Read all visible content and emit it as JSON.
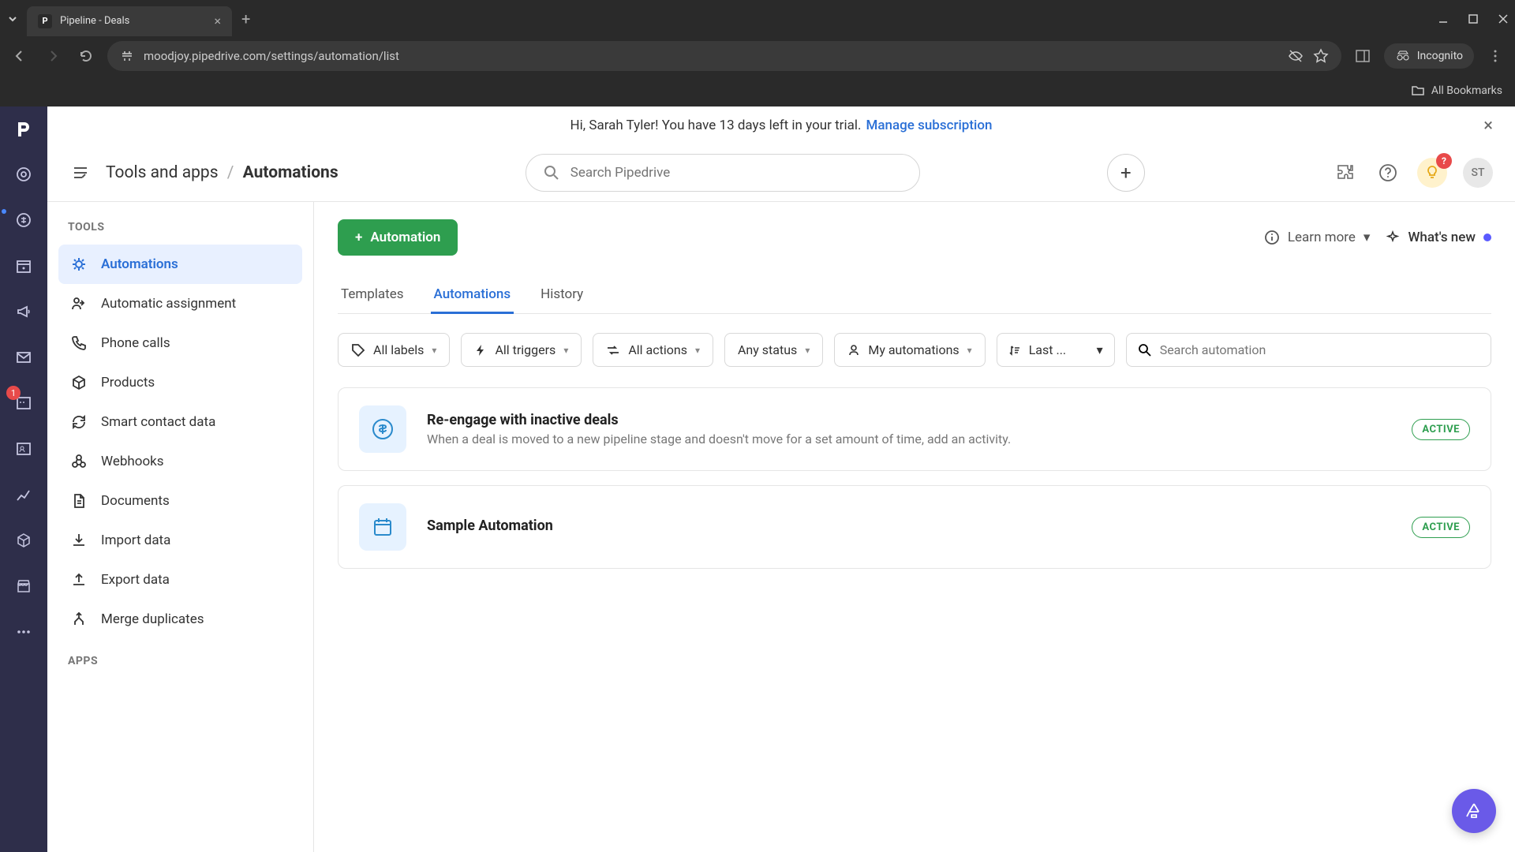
{
  "browser": {
    "tab_title": "Pipeline - Deals",
    "url": "moodjoy.pipedrive.com/settings/automation/list",
    "incognito_label": "Incognito",
    "bookmarks_label": "All Bookmarks"
  },
  "banner": {
    "greeting": "Hi, Sarah Tyler! You have 13 days left in your trial.",
    "link": "Manage subscription"
  },
  "breadcrumb": {
    "parent": "Tools and apps",
    "current": "Automations"
  },
  "search": {
    "placeholder": "Search Pipedrive"
  },
  "rail": {
    "badge_count": "1"
  },
  "header_right": {
    "bulb_badge": "?",
    "avatar_initials": "ST"
  },
  "sidebar": {
    "section1_title": "TOOLS",
    "section2_title": "APPS",
    "items": [
      {
        "label": "Automations"
      },
      {
        "label": "Automatic assignment"
      },
      {
        "label": "Phone calls"
      },
      {
        "label": "Products"
      },
      {
        "label": "Smart contact data"
      },
      {
        "label": "Webhooks"
      },
      {
        "label": "Documents"
      },
      {
        "label": "Import data"
      },
      {
        "label": "Export data"
      },
      {
        "label": "Merge duplicates"
      }
    ]
  },
  "content": {
    "primary_button": "Automation",
    "learn_more": "Learn more",
    "whats_new": "What's new"
  },
  "tabs": [
    {
      "label": "Templates"
    },
    {
      "label": "Automations"
    },
    {
      "label": "History"
    }
  ],
  "filters": {
    "labels": "All labels",
    "triggers": "All triggers",
    "actions": "All actions",
    "status": "Any status",
    "owner": "My automations",
    "sort": "Last ...",
    "search_placeholder": "Search automation"
  },
  "automations": [
    {
      "title": "Re-engage with inactive deals",
      "desc": "When a deal is moved to a new pipeline stage and doesn't move for a set amount of time, add an activity.",
      "status": "ACTIVE",
      "icon": "dollar"
    },
    {
      "title": "Sample Automation",
      "desc": "",
      "status": "ACTIVE",
      "icon": "calendar"
    }
  ]
}
